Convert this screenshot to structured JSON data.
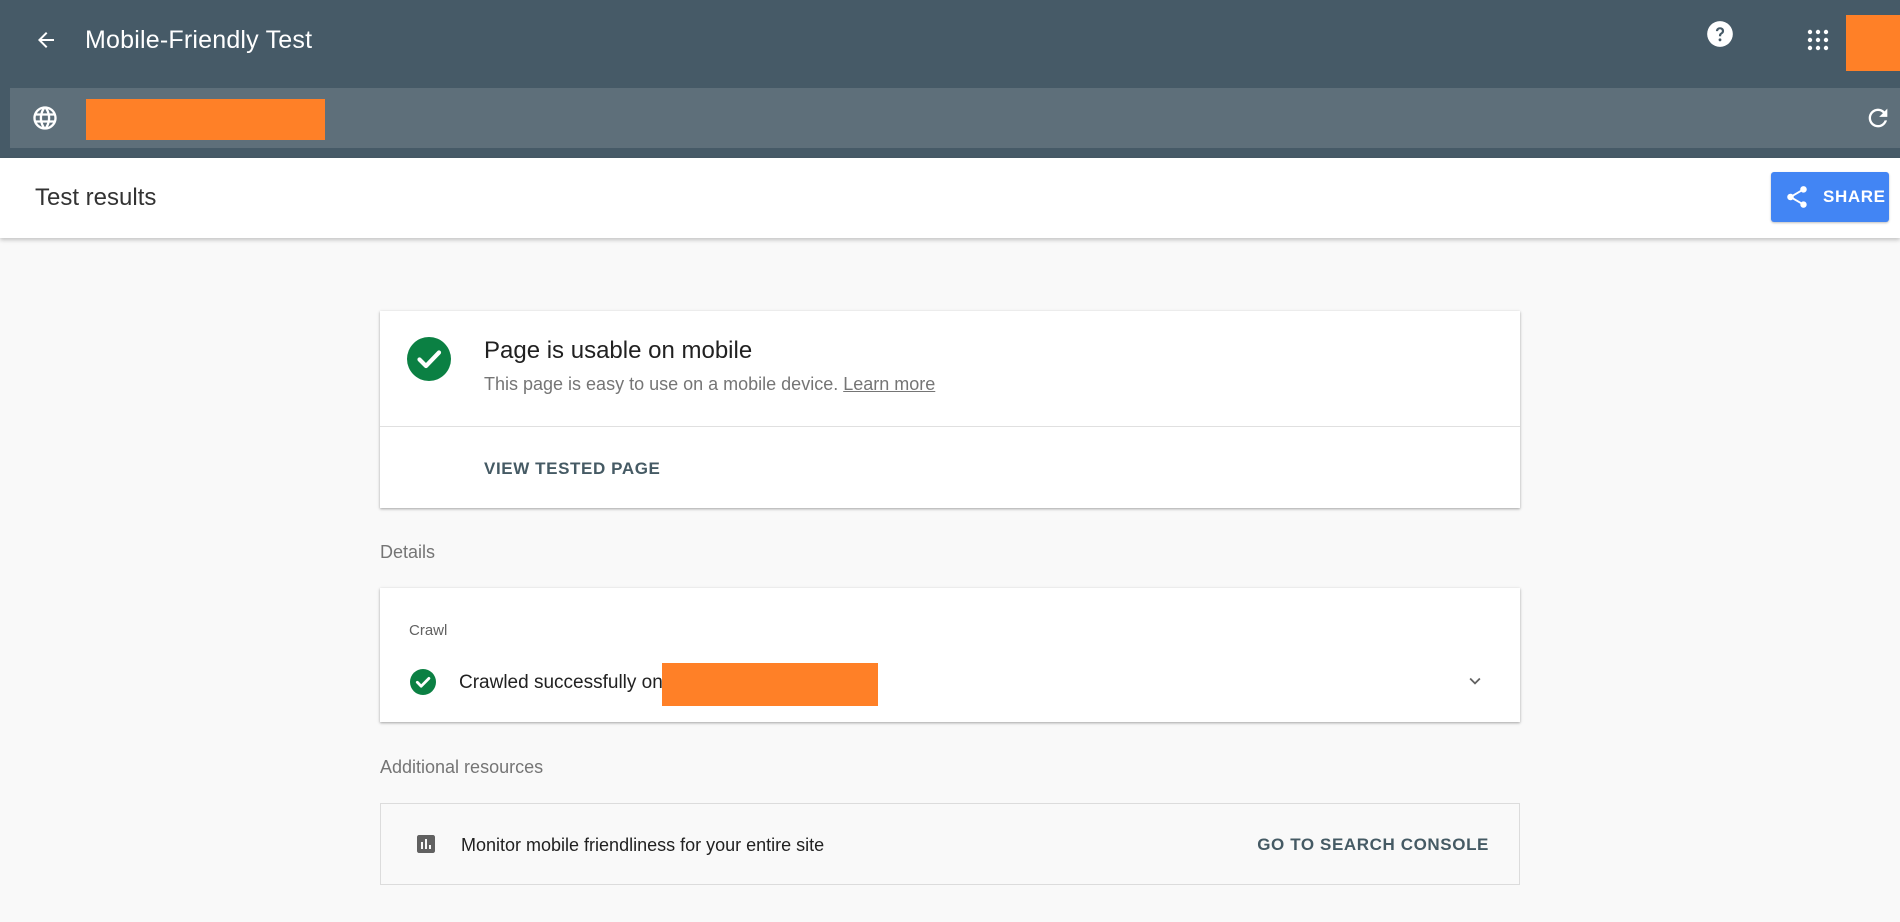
{
  "app": {
    "title": "Mobile-Friendly Test"
  },
  "header": {
    "back_icon": "arrow-back-icon",
    "help_icon": "help-icon",
    "apps_icon": "apps-grid-icon"
  },
  "url_bar": {
    "globe_icon": "globe-icon",
    "reload_icon": "reload-icon"
  },
  "results_header": {
    "title": "Test results",
    "share_label": "SHARE",
    "share_icon": "share-icon"
  },
  "result_card": {
    "status_icon": "check-circle-icon",
    "title": "Page is usable on mobile",
    "subtitle": "This page is easy to use on a mobile device.",
    "learn_more": "Learn more",
    "view_tested_page": "VIEW TESTED PAGE"
  },
  "details": {
    "label": "Details",
    "crawl_heading": "Crawl",
    "crawl_text": "Crawled successfully on",
    "expand_icon": "chevron-down-icon"
  },
  "additional_resources": {
    "label": "Additional resources",
    "icon": "bar-chart-icon",
    "text": "Monitor mobile friendliness for your entire site",
    "link": "GO TO SEARCH CONSOLE"
  },
  "colors": {
    "header_bg": "#465a67",
    "urlbar_bg": "#5e6f7a",
    "accent_blue": "#4285f4",
    "success_green": "#0b8043",
    "redaction": "#ff8027"
  }
}
